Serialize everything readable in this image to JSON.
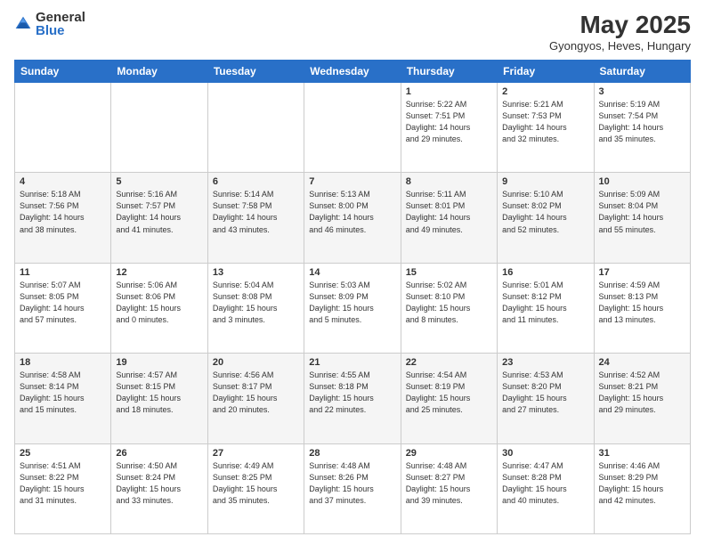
{
  "header": {
    "logo_general": "General",
    "logo_blue": "Blue",
    "title": "May 2025",
    "subtitle": "Gyongyos, Heves, Hungary"
  },
  "weekdays": [
    "Sunday",
    "Monday",
    "Tuesday",
    "Wednesday",
    "Thursday",
    "Friday",
    "Saturday"
  ],
  "weeks": [
    [
      {
        "day": "",
        "info": ""
      },
      {
        "day": "",
        "info": ""
      },
      {
        "day": "",
        "info": ""
      },
      {
        "day": "",
        "info": ""
      },
      {
        "day": "1",
        "info": "Sunrise: 5:22 AM\nSunset: 7:51 PM\nDaylight: 14 hours\nand 29 minutes."
      },
      {
        "day": "2",
        "info": "Sunrise: 5:21 AM\nSunset: 7:53 PM\nDaylight: 14 hours\nand 32 minutes."
      },
      {
        "day": "3",
        "info": "Sunrise: 5:19 AM\nSunset: 7:54 PM\nDaylight: 14 hours\nand 35 minutes."
      }
    ],
    [
      {
        "day": "4",
        "info": "Sunrise: 5:18 AM\nSunset: 7:56 PM\nDaylight: 14 hours\nand 38 minutes."
      },
      {
        "day": "5",
        "info": "Sunrise: 5:16 AM\nSunset: 7:57 PM\nDaylight: 14 hours\nand 41 minutes."
      },
      {
        "day": "6",
        "info": "Sunrise: 5:14 AM\nSunset: 7:58 PM\nDaylight: 14 hours\nand 43 minutes."
      },
      {
        "day": "7",
        "info": "Sunrise: 5:13 AM\nSunset: 8:00 PM\nDaylight: 14 hours\nand 46 minutes."
      },
      {
        "day": "8",
        "info": "Sunrise: 5:11 AM\nSunset: 8:01 PM\nDaylight: 14 hours\nand 49 minutes."
      },
      {
        "day": "9",
        "info": "Sunrise: 5:10 AM\nSunset: 8:02 PM\nDaylight: 14 hours\nand 52 minutes."
      },
      {
        "day": "10",
        "info": "Sunrise: 5:09 AM\nSunset: 8:04 PM\nDaylight: 14 hours\nand 55 minutes."
      }
    ],
    [
      {
        "day": "11",
        "info": "Sunrise: 5:07 AM\nSunset: 8:05 PM\nDaylight: 14 hours\nand 57 minutes."
      },
      {
        "day": "12",
        "info": "Sunrise: 5:06 AM\nSunset: 8:06 PM\nDaylight: 15 hours\nand 0 minutes."
      },
      {
        "day": "13",
        "info": "Sunrise: 5:04 AM\nSunset: 8:08 PM\nDaylight: 15 hours\nand 3 minutes."
      },
      {
        "day": "14",
        "info": "Sunrise: 5:03 AM\nSunset: 8:09 PM\nDaylight: 15 hours\nand 5 minutes."
      },
      {
        "day": "15",
        "info": "Sunrise: 5:02 AM\nSunset: 8:10 PM\nDaylight: 15 hours\nand 8 minutes."
      },
      {
        "day": "16",
        "info": "Sunrise: 5:01 AM\nSunset: 8:12 PM\nDaylight: 15 hours\nand 11 minutes."
      },
      {
        "day": "17",
        "info": "Sunrise: 4:59 AM\nSunset: 8:13 PM\nDaylight: 15 hours\nand 13 minutes."
      }
    ],
    [
      {
        "day": "18",
        "info": "Sunrise: 4:58 AM\nSunset: 8:14 PM\nDaylight: 15 hours\nand 15 minutes."
      },
      {
        "day": "19",
        "info": "Sunrise: 4:57 AM\nSunset: 8:15 PM\nDaylight: 15 hours\nand 18 minutes."
      },
      {
        "day": "20",
        "info": "Sunrise: 4:56 AM\nSunset: 8:17 PM\nDaylight: 15 hours\nand 20 minutes."
      },
      {
        "day": "21",
        "info": "Sunrise: 4:55 AM\nSunset: 8:18 PM\nDaylight: 15 hours\nand 22 minutes."
      },
      {
        "day": "22",
        "info": "Sunrise: 4:54 AM\nSunset: 8:19 PM\nDaylight: 15 hours\nand 25 minutes."
      },
      {
        "day": "23",
        "info": "Sunrise: 4:53 AM\nSunset: 8:20 PM\nDaylight: 15 hours\nand 27 minutes."
      },
      {
        "day": "24",
        "info": "Sunrise: 4:52 AM\nSunset: 8:21 PM\nDaylight: 15 hours\nand 29 minutes."
      }
    ],
    [
      {
        "day": "25",
        "info": "Sunrise: 4:51 AM\nSunset: 8:22 PM\nDaylight: 15 hours\nand 31 minutes."
      },
      {
        "day": "26",
        "info": "Sunrise: 4:50 AM\nSunset: 8:24 PM\nDaylight: 15 hours\nand 33 minutes."
      },
      {
        "day": "27",
        "info": "Sunrise: 4:49 AM\nSunset: 8:25 PM\nDaylight: 15 hours\nand 35 minutes."
      },
      {
        "day": "28",
        "info": "Sunrise: 4:48 AM\nSunset: 8:26 PM\nDaylight: 15 hours\nand 37 minutes."
      },
      {
        "day": "29",
        "info": "Sunrise: 4:48 AM\nSunset: 8:27 PM\nDaylight: 15 hours\nand 39 minutes."
      },
      {
        "day": "30",
        "info": "Sunrise: 4:47 AM\nSunset: 8:28 PM\nDaylight: 15 hours\nand 40 minutes."
      },
      {
        "day": "31",
        "info": "Sunrise: 4:46 AM\nSunset: 8:29 PM\nDaylight: 15 hours\nand 42 minutes."
      }
    ]
  ]
}
